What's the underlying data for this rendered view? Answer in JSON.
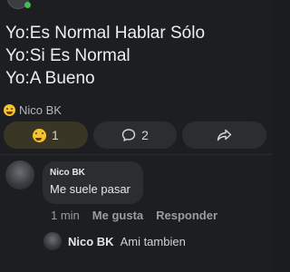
{
  "post": {
    "lines": [
      "Yo:Es Normal Hablar Sólo",
      "Yo:Si Es Normal",
      "Yo:A Bueno"
    ]
  },
  "reactions": {
    "summary_name": "Nico BK",
    "summary_icon": "laughing-emoji-icon"
  },
  "actions": {
    "react_count": "1",
    "comment_count": "2",
    "react_icon": "laughing-emoji-icon",
    "comment_icon": "comment-bubble-icon",
    "share_icon": "share-arrow-icon"
  },
  "comment": {
    "author": "Nico BK",
    "text": "Me suele pasar",
    "time": "1 min",
    "like_label": "Me gusta",
    "reply_label": "Responder"
  },
  "reply": {
    "author": "Nico BK",
    "text": "Ami tambien"
  },
  "colors": {
    "background": "#1d1e21",
    "card": "#2c2d31",
    "emoji": "#f4c430",
    "online": "#3fbf4f"
  }
}
